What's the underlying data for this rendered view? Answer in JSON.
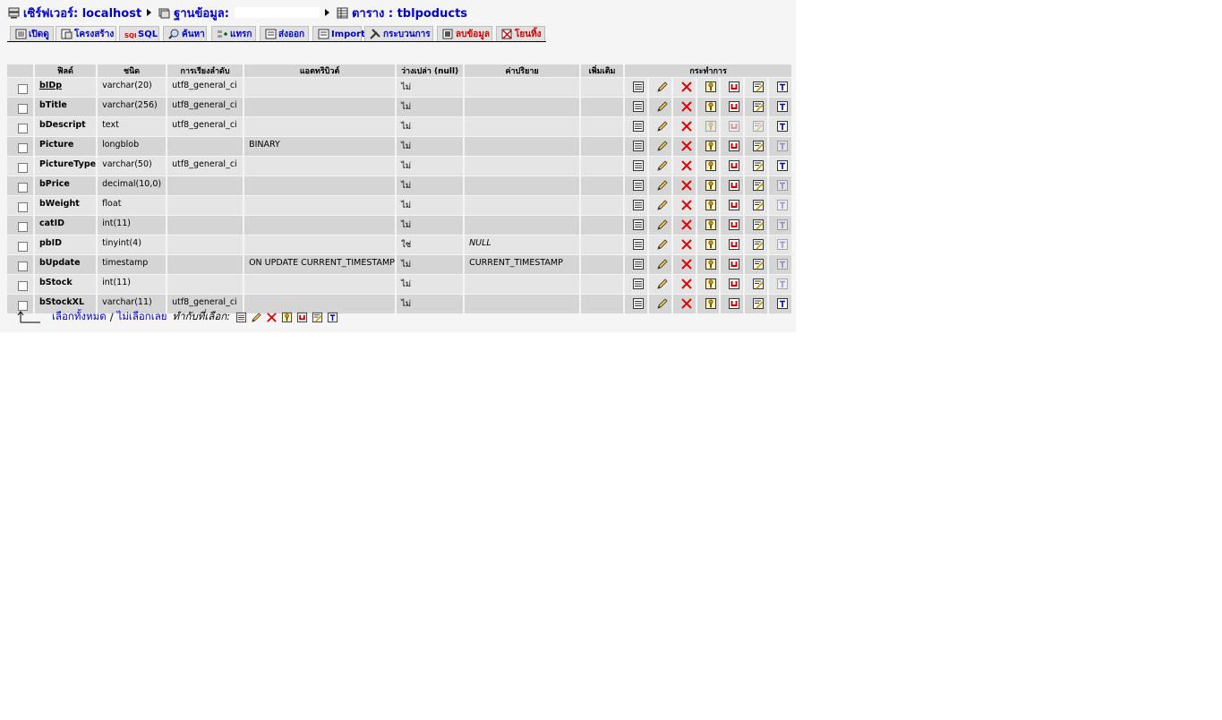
{
  "breadcrumb": {
    "server": "เซิร์ฟเวอร์: localhost",
    "database": "ฐานข้อมูล:",
    "table": "ตาราง : tblpoducts"
  },
  "tabs": [
    {
      "label": "เปิดดู",
      "icon": "browse-icon"
    },
    {
      "label": "โครงสร้าง",
      "icon": "structure-icon"
    },
    {
      "label": "SQL",
      "icon": "sql-icon"
    },
    {
      "label": "ค้นหา",
      "icon": "search-icon"
    },
    {
      "label": "แทรก",
      "icon": "insert-icon"
    },
    {
      "label": "ส่งออก",
      "icon": "export-icon"
    },
    {
      "label": "Import",
      "icon": "import-icon"
    },
    {
      "label": "กระบวนการ",
      "icon": "operations-icon"
    },
    {
      "label": "ลบข้อมูล",
      "icon": "empty-icon"
    },
    {
      "label": "โยนทิ้ง",
      "icon": "drop-icon"
    }
  ],
  "headers": {
    "field": "ฟิลด์",
    "type": "ชนิด",
    "collation": "การเรียงลำดับ",
    "attributes": "แอตทริบิวต์",
    "null": "ว่างเปล่า (null)",
    "default": "ค่าปริยาย",
    "extra": "เพิ่มเติม",
    "action": "กระทำการ"
  },
  "rows": [
    {
      "field": "bIDp",
      "type": "varchar(20)",
      "collation": "utf8_general_ci",
      "attributes": "",
      "null": "ไม่",
      "default": "",
      "extra": "",
      "primary": true
    },
    {
      "field": "bTitle",
      "type": "varchar(256)",
      "collation": "utf8_general_ci",
      "attributes": "",
      "null": "ไม่",
      "default": "",
      "extra": ""
    },
    {
      "field": "bDescript",
      "type": "text",
      "collation": "utf8_general_ci",
      "attributes": "",
      "null": "ไม่",
      "default": "",
      "extra": ""
    },
    {
      "field": "Picture",
      "type": "longblob",
      "collation": "",
      "attributes": "BINARY",
      "null": "ไม่",
      "default": "",
      "extra": ""
    },
    {
      "field": "PictureType",
      "type": "varchar(50)",
      "collation": "utf8_general_ci",
      "attributes": "",
      "null": "ไม่",
      "default": "",
      "extra": ""
    },
    {
      "field": "bPrice",
      "type": "decimal(10,0)",
      "collation": "",
      "attributes": "",
      "null": "ไม่",
      "default": "",
      "extra": ""
    },
    {
      "field": "bWeight",
      "type": "float",
      "collation": "",
      "attributes": "",
      "null": "ไม่",
      "default": "",
      "extra": ""
    },
    {
      "field": "catID",
      "type": "int(11)",
      "collation": "",
      "attributes": "",
      "null": "ไม่",
      "default": "",
      "extra": ""
    },
    {
      "field": "pbID",
      "type": "tinyint(4)",
      "collation": "",
      "attributes": "",
      "null": "ใช่",
      "default": "NULL",
      "extra": ""
    },
    {
      "field": "bUpdate",
      "type": "timestamp",
      "collation": "",
      "attributes": "ON UPDATE CURRENT_TIMESTAMP",
      "null": "ไม่",
      "default": "CURRENT_TIMESTAMP",
      "extra": ""
    },
    {
      "field": "bStock",
      "type": "int(11)",
      "collation": "",
      "attributes": "",
      "null": "ไม่",
      "default": "",
      "extra": ""
    },
    {
      "field": "bStockXL",
      "type": "varchar(11)",
      "collation": "utf8_general_ci",
      "attributes": "",
      "null": "ไม่",
      "default": "",
      "extra": ""
    }
  ],
  "row_actions": [
    "browse-distinct-icon",
    "edit-icon",
    "drop-icon",
    "primary-key-icon",
    "unique-icon",
    "index-icon",
    "fulltext-icon"
  ],
  "footer": {
    "check_all": "เลือกทั้งหมด",
    "separator": "/",
    "uncheck_all": "ไม่เลือกเลย",
    "with_selected": "ทำกับที่เลือก:"
  },
  "colors": {
    "link": "#0000cc",
    "drop_red": "#cc0000",
    "row_odd": "#e5e5e5",
    "row_even": "#d5d5d5",
    "panel_bg": "#f5f5f5"
  }
}
